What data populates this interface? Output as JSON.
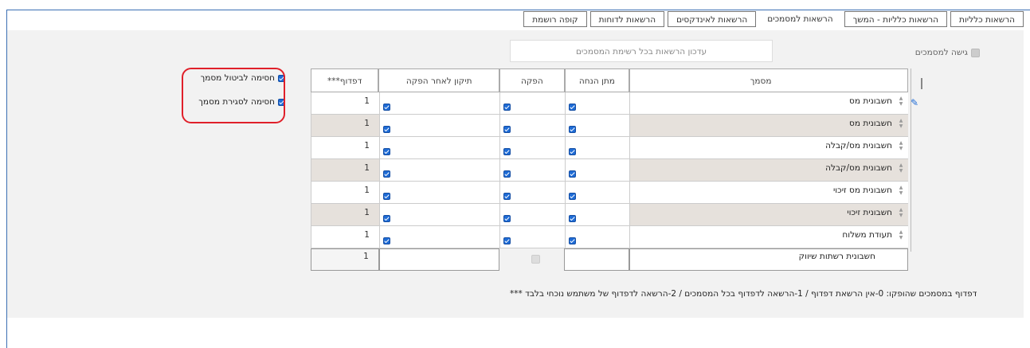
{
  "tabs": [
    {
      "label": "הרשאות כלליות",
      "active": false
    },
    {
      "label": "הרשאות כלליות - המשך",
      "active": false
    },
    {
      "label": "הרשאות למסמכים",
      "active": true
    },
    {
      "label": "הרשאות לאינדקסים",
      "active": false
    },
    {
      "label": "הרשאות לדוחות",
      "active": false
    },
    {
      "label": "קופה רושמת",
      "active": false
    }
  ],
  "update_button": "עדכון הרשאות בכל רשימת המסמכים",
  "doc_access_label": "גישה למסמכים",
  "block_options": [
    {
      "label": "חסימה לביטול מסמך",
      "checked": true
    },
    {
      "label": "חסימה לסגירת מסמך",
      "checked": true
    }
  ],
  "columns": {
    "document": "מסמך",
    "give_discount": "מתן הנחה",
    "print": "הפקה",
    "fix_after_print": "תיקון לאחר הפקה",
    "printing": "***דפדוף"
  },
  "rows": [
    {
      "document": "חשבונית מס",
      "give_discount": true,
      "print": true,
      "fix_after_print": true,
      "printing": "1"
    },
    {
      "document": "חשבונית מס",
      "give_discount": true,
      "print": true,
      "fix_after_print": true,
      "printing": "1"
    },
    {
      "document": "חשבונית מס/קבלה",
      "give_discount": true,
      "print": true,
      "fix_after_print": true,
      "printing": "1"
    },
    {
      "document": "חשבונית מס/קבלה",
      "give_discount": true,
      "print": true,
      "fix_after_print": true,
      "printing": "1"
    },
    {
      "document": "חשבונית מס זיכוי",
      "give_discount": true,
      "print": true,
      "fix_after_print": true,
      "printing": "1"
    },
    {
      "document": "חשבונית זיכוי",
      "give_discount": true,
      "print": true,
      "fix_after_print": true,
      "printing": "1"
    },
    {
      "document": "תעודת משלוח",
      "give_discount": true,
      "print": true,
      "fix_after_print": true,
      "printing": "1"
    }
  ],
  "last_row": {
    "document": "חשבונית רשתות שיווק",
    "printing": "1"
  },
  "footnote": "*** דפדוף במסמכים שהופקו: 0-אין הרשאת דפדוף / 1-הרשאה לדפדוף בכל המסמכים / 2-הרשאה לדפדוף של משתמש נוכחי בלבד"
}
